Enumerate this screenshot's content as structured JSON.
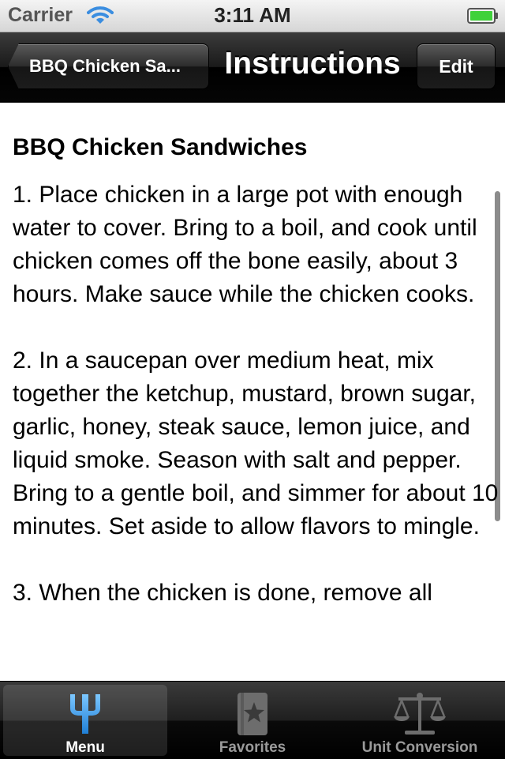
{
  "status_bar": {
    "carrier": "Carrier",
    "time": "3:11 AM",
    "wifi_icon": "wifi-icon",
    "battery_icon": "battery-icon",
    "battery_color": "#3fd13a"
  },
  "nav_bar": {
    "back_label": "BBQ Chicken Sa...",
    "title": "Instructions",
    "edit_label": "Edit"
  },
  "recipe": {
    "title": "BBQ Chicken Sandwiches",
    "steps": [
      "1. Place chicken in a large pot with enough water to cover. Bring to a boil, and cook until chicken comes off the bone easily, about 3 hours. Make sauce while the chicken cooks.",
      "2. In a saucepan over medium heat, mix together the ketchup, mustard, brown sugar, garlic, honey, steak sauce, lemon juice, and liquid smoke. Season with salt and pepper. Bring to a gentle boil, and simmer for about 10 minutes. Set aside to allow flavors to mingle.",
      "3. When the chicken is done, remove all"
    ]
  },
  "tab_bar": {
    "accent_color": "#3aa3ff",
    "tabs": [
      {
        "label": "Menu",
        "icon": "fork-icon",
        "selected": true
      },
      {
        "label": "Favorites",
        "icon": "favorites-star-icon",
        "selected": false
      },
      {
        "label": "Unit Conversion",
        "icon": "scale-icon",
        "selected": false
      }
    ]
  }
}
